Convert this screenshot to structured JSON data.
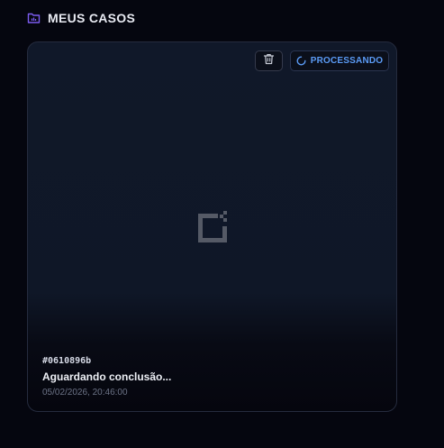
{
  "header": {
    "icon": "folder-chart-icon",
    "title": "MEUS CASOS",
    "accent_color": "#7c5cf0"
  },
  "card": {
    "delete_icon": "trash-icon",
    "status": {
      "icon": "spinner-icon",
      "label": "PROCESSANDO",
      "color": "#5b9bf5"
    },
    "placeholder_icon": "image-placeholder-icon",
    "case_id": "#0610896b",
    "title": "Aguardando conclusão...",
    "date": "05/02/2026, 20:46:00"
  }
}
